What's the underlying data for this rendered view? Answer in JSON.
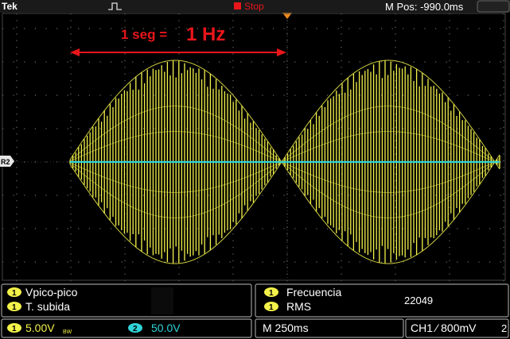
{
  "topbar": {
    "brand": "Tek",
    "run_state": "Stop",
    "m_pos": "M Pos: -990.0ms"
  },
  "annotation": {
    "label_prefix": "1 seg = ",
    "label_big": "1 Hz"
  },
  "markers": {
    "ch2_label": "R2"
  },
  "measurements": {
    "left": [
      {
        "channel": "1",
        "label": "Vpico-pico",
        "value": ""
      },
      {
        "channel": "1",
        "label": "T. subida",
        "value": ""
      }
    ],
    "right": [
      {
        "channel": "1",
        "label": "Frecuencia",
        "value": ""
      },
      {
        "channel": "1",
        "label": "RMS",
        "value": ""
      }
    ],
    "counter_value": "22049"
  },
  "status": {
    "ch1_num": "1",
    "ch1_scale": "5.00V",
    "ch1_suffix": "BW",
    "ch2_num": "2",
    "ch2_scale": "50.0V",
    "timebase": "M 250ms",
    "trigger": "CH1 ⁄ 800mV",
    "trigger_extra": "2"
  },
  "colors": {
    "ch1": "#f3f24a",
    "ch2": "#2fd3d8",
    "annotation": "#e8161b",
    "grid": "#6d6d6d",
    "trigger_marker": "#f28c18"
  }
}
